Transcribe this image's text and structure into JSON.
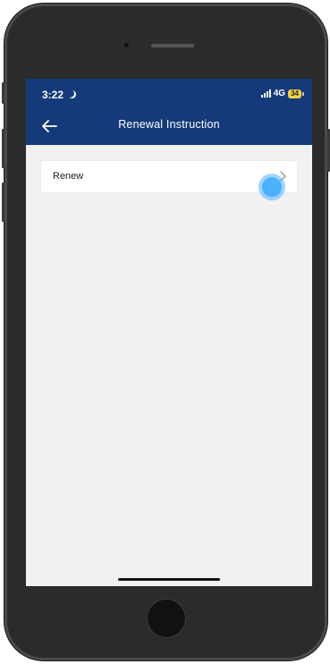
{
  "status_bar": {
    "time": "3:22",
    "network": "4G",
    "battery": "34",
    "icons": [
      "moon-icon",
      "signal-icon",
      "battery-icon"
    ]
  },
  "header": {
    "title": "Renewal Instruction",
    "back_icon": "arrow-left-icon"
  },
  "list": {
    "items": [
      {
        "label": "Renew",
        "icon": "chevron-right-icon"
      }
    ]
  },
  "colors": {
    "header_bg": "#153a7a",
    "screen_bg": "#f1f1f1",
    "card_bg": "#ffffff",
    "tap_indicator": "#3caafa",
    "battery": "#f4d03f"
  }
}
